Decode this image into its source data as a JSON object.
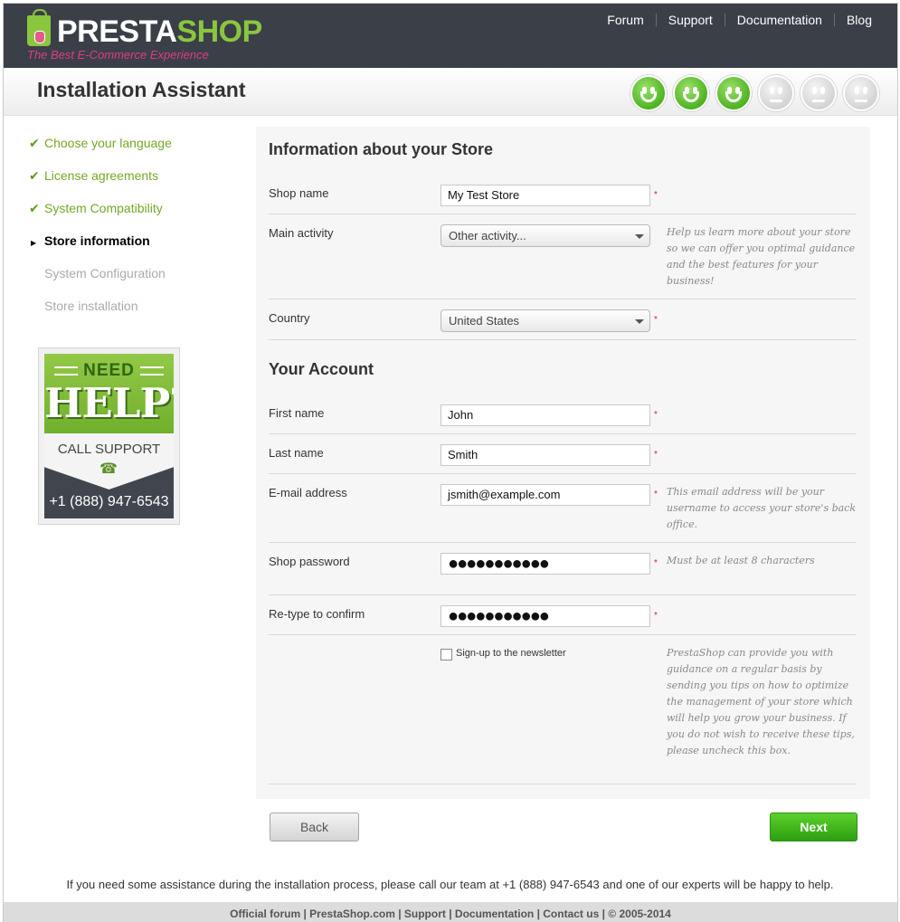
{
  "header": {
    "logo_text_1": "PRESTA",
    "logo_text_2": "SHOP",
    "tagline": "The Best E-Commerce Experience",
    "nav": [
      "Forum",
      "Support",
      "Documentation",
      "Blog"
    ]
  },
  "title": "Installation Assistant",
  "progress": {
    "completed_steps": 3,
    "total_steps": 6
  },
  "steps": [
    {
      "label": "Choose your language",
      "state": "done"
    },
    {
      "label": "License agreements",
      "state": "done"
    },
    {
      "label": "System Compatibility",
      "state": "done"
    },
    {
      "label": "Store information",
      "state": "current"
    },
    {
      "label": "System Configuration",
      "state": "todo"
    },
    {
      "label": "Store installation",
      "state": "todo"
    }
  ],
  "help_box": {
    "need": "NEED",
    "help": "HELP?",
    "call": "CALL SUPPORT",
    "phone": "+1 (888) 947-6543"
  },
  "store": {
    "title": "Information about your Store",
    "shop_name_label": "Shop name",
    "shop_name_value": "My Test Store",
    "activity_label": "Main activity",
    "activity_value": "Other activity...",
    "activity_hint": "Help us learn more about your store so we can offer you optimal guidance and the best features for your business!",
    "country_label": "Country",
    "country_value": "United States"
  },
  "account": {
    "title": "Your Account",
    "first_name_label": "First name",
    "first_name_value": "John",
    "last_name_label": "Last name",
    "last_name_value": "Smith",
    "email_label": "E-mail address",
    "email_value": "jsmith@example.com",
    "email_hint": "This email address will be your username to access your store's back office.",
    "password_label": "Shop password",
    "password_mask": "●●●●●●●●●●●",
    "password_hint": "Must be at least 8 characters",
    "confirm_label": "Re-type to confirm",
    "confirm_mask": "●●●●●●●●●●●",
    "newsletter_label": "Sign-up to the newsletter",
    "newsletter_checked": false,
    "newsletter_hint": "PrestaShop can provide you with guidance on a regular basis by sending you tips on how to optimize the management of your store which will help you grow your business. If you do not wish to receive these tips, please uncheck this box."
  },
  "required_marker": "*",
  "buttons": {
    "back": "Back",
    "next": "Next"
  },
  "assistance": "If you need some assistance during the installation process, please call our team at +1 (888) 947-6543 and one of our experts will be happy to help.",
  "footer": "Official forum | PrestaShop.com | Support | Documentation | Contact us | © 2005-2014",
  "colors": {
    "header_bg": "#3b3f48",
    "brand_green": "#8bc63f",
    "brand_pink": "#df3d84",
    "done_green": "#73a826",
    "next_button": "#3cb01a"
  }
}
